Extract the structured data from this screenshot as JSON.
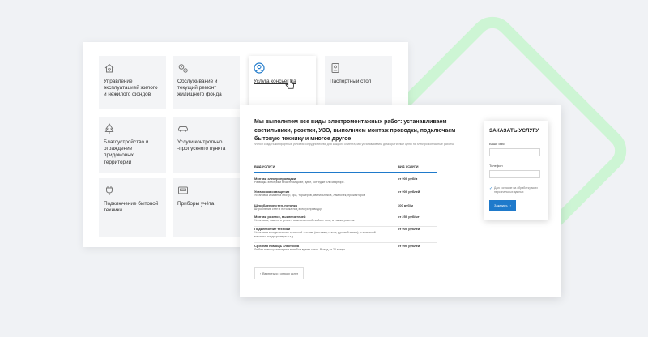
{
  "services": [
    {
      "label": "Управление эксплуатацией жилого и нежилого фондов",
      "icon": "house-heart-icon"
    },
    {
      "label": "Обслуживание и текущий ремонт жилищного фонда",
      "icon": "gears-icon"
    },
    {
      "label": "Услуга консьержа",
      "icon": "user-circle-icon"
    },
    {
      "label": "Паспортный стол",
      "icon": "passport-icon"
    },
    {
      "label": "Благоустройство и ограждение придомовых территорий",
      "icon": "tree-icon"
    },
    {
      "label": "Услуги контрольно -пропускного пункта",
      "icon": "car-icon"
    },
    {
      "label": "Подключение бытовой техники",
      "icon": "plug-icon"
    },
    {
      "label": "Приборы учёта",
      "icon": "meter-icon"
    }
  ],
  "detail": {
    "title": "Мы выполняем все виды электромонтажных работ: устанавливаем светильники, розетки, УЗО, выполняем монтаж проводки, подключаем бытовую технику и многое другое",
    "intro": "Фолой создать комфортные условия сотрудничества для каждого клиента, мы устанавливаем демократичные цены на электромонтажные работы",
    "col_service": "ВИД УСЛУГИ",
    "col_price": "ВИД УСЛУГИ",
    "rows": [
      {
        "name": "Монтаж электропроводки",
        "desc": "Разводка электрики в частном доме, даче, коттедже или квартире.",
        "price": "от 900 руб/м"
      },
      {
        "name": "Установка освещения",
        "desc": "Установка и замена люстр, бра, торшеров, светильников, лампочек, прожекторов",
        "price": "от 900 рублей"
      },
      {
        "name": "Штробление стен, потолка",
        "desc": "Штробление стен и потолка под электропроводку",
        "price": "300 руб/м"
      },
      {
        "name": "Монтаж розеток, выключателей",
        "desc": "Установка, замена и ремонт выключателей любого типа, а так же розеток.",
        "price": "от 250 руб/шт"
      },
      {
        "name": "Подключение техники",
        "desc": "Установка и подключение кухонной техники (вытяжка, плита, духовой шкаф), стиральной машины, кондиционера и т.д.",
        "price": "от 900 рублей"
      },
      {
        "name": "Срочная помощь электрика",
        "desc": "Любая помощь электрика в любое время суток. Выезд за 20 минут.",
        "price": "от 990 рублей"
      }
    ],
    "back_label": "Вернуться к списку услуг"
  },
  "order": {
    "title": "ЗАКАЗАТЬ УСЛУГУ",
    "name_label": "Ваше имя",
    "phone_label": "Телефон",
    "consent_text": "Даю согласие на обработку",
    "consent_link": "моих персональных данных",
    "submit_label": "Заказать"
  },
  "colors": {
    "accent": "#1f7acb",
    "diamond": "#cdf5d4",
    "tile": "#f3f4f6"
  }
}
